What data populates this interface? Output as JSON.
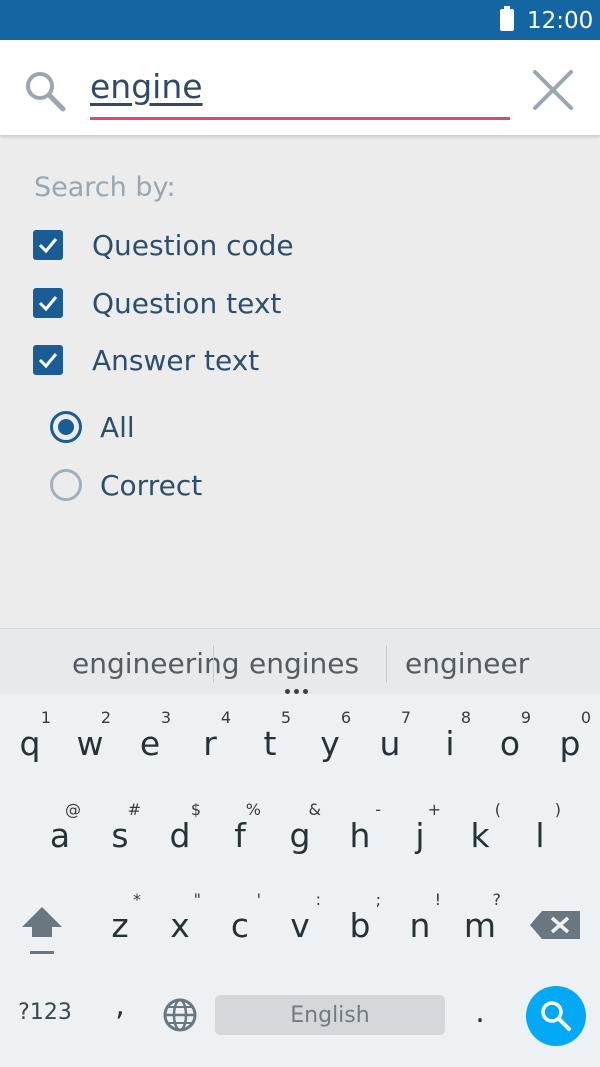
{
  "status_bar": {
    "time": "12:00"
  },
  "search": {
    "value": "engine"
  },
  "options": {
    "heading": "Search by:",
    "checkboxes": [
      {
        "label": "Question code",
        "checked": true
      },
      {
        "label": "Question text",
        "checked": true
      },
      {
        "label": "Answer text",
        "checked": true
      }
    ],
    "radios": [
      {
        "label": "All",
        "selected": true
      },
      {
        "label": "Correct",
        "selected": false
      }
    ]
  },
  "keyboard": {
    "suggestions": [
      "engineering",
      "engines",
      "engineer"
    ],
    "row1": [
      {
        "key": "q",
        "hint": "1"
      },
      {
        "key": "w",
        "hint": "2"
      },
      {
        "key": "e",
        "hint": "3"
      },
      {
        "key": "r",
        "hint": "4"
      },
      {
        "key": "t",
        "hint": "5"
      },
      {
        "key": "y",
        "hint": "6"
      },
      {
        "key": "u",
        "hint": "7"
      },
      {
        "key": "i",
        "hint": "8"
      },
      {
        "key": "o",
        "hint": "9"
      },
      {
        "key": "p",
        "hint": "0"
      }
    ],
    "row2": [
      {
        "key": "a",
        "hint": "@"
      },
      {
        "key": "s",
        "hint": "#"
      },
      {
        "key": "d",
        "hint": "$"
      },
      {
        "key": "f",
        "hint": "%"
      },
      {
        "key": "g",
        "hint": "&"
      },
      {
        "key": "h",
        "hint": "-"
      },
      {
        "key": "j",
        "hint": "+"
      },
      {
        "key": "k",
        "hint": "("
      },
      {
        "key": "l",
        "hint": ")"
      }
    ],
    "row3": [
      {
        "key": "z",
        "hint": "*"
      },
      {
        "key": "x",
        "hint": "\""
      },
      {
        "key": "c",
        "hint": "'"
      },
      {
        "key": "v",
        "hint": ":"
      },
      {
        "key": "b",
        "hint": ";"
      },
      {
        "key": "n",
        "hint": "!"
      },
      {
        "key": "m",
        "hint": "?"
      }
    ],
    "mode_label": "?123",
    "comma": ",",
    "space_label": "English",
    "period": "."
  },
  "colors": {
    "status_bar": "#1466a3",
    "accent": "#1a5d94",
    "underline": "#e0457b",
    "action_key": "#03a9f4"
  }
}
